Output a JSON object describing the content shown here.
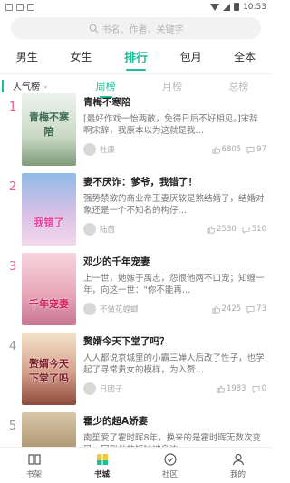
{
  "status_bar": {
    "time": "10:53"
  },
  "search": {
    "placeholder": "书名、作者、关键字"
  },
  "top_tabs": [
    {
      "label": "男生",
      "active": false
    },
    {
      "label": "女生",
      "active": false
    },
    {
      "label": "排行",
      "active": true
    },
    {
      "label": "包月",
      "active": false
    },
    {
      "label": "全本",
      "active": false
    }
  ],
  "rank_select": {
    "label": "人气榜"
  },
  "periods": [
    {
      "label": "周榜",
      "active": true
    },
    {
      "label": "月榜",
      "active": false
    },
    {
      "label": "总榜",
      "active": false
    }
  ],
  "books": [
    {
      "rank": "1",
      "title": "青梅不寒陪",
      "cover_text": "青梅不寒陪",
      "desc": "[最好作戏一怡两散，免得日后不好相见。]宋辞啊宋辞，我原本以为这就是我…",
      "author": "杜康",
      "likes": "6805",
      "comments": "97"
    },
    {
      "rank": "2",
      "title": "妻不厌诈：爹爷，我错了！",
      "cover_text": "我错了",
      "desc": "强势禁欲的商业帝王妻厌软是煞结婚了，结婚对象还是一个不知名的构仔…",
      "author": "陆茵",
      "likes": "2530",
      "comments": "510"
    },
    {
      "rank": "3",
      "title": "邓少的千年宠妻",
      "cover_text": "千年宠妻",
      "desc": "上一世，她嫁于禹志，怨恨他两不口宠；知缠一年，向这一世：\"你不能再…",
      "author": "不做花螳螂",
      "likes": "2425",
      "comments": "73"
    },
    {
      "rank": "4",
      "title": "赘婿今天下堂了吗？",
      "cover_text": "赘婿今天下堂了吗",
      "desc": "人人都说京城里的小霸三婵人后改了性子，也学起了寻常贵女的模样，为入赘…",
      "author": "日团子",
      "likes": "1983",
      "comments": "0"
    },
    {
      "rank": "5",
      "title": "霍少的超A娇妻",
      "cover_text": "",
      "desc": "南笙爱了霍时晖8年，换来的是霍时晖无数次变异，回到他的短钵被身边…",
      "author": "",
      "likes": "",
      "comments": ""
    }
  ],
  "bottom_nav": [
    {
      "label": "书架",
      "icon": "bookshelf-icon",
      "active": false
    },
    {
      "label": "书城",
      "icon": "bookstore-icon",
      "active": true
    },
    {
      "label": "社区",
      "icon": "community-icon",
      "active": false
    },
    {
      "label": "我的",
      "icon": "profile-icon",
      "active": false
    }
  ],
  "colors": {
    "accent": "#1cbf9a",
    "rank_pink": "#e85a8b"
  }
}
